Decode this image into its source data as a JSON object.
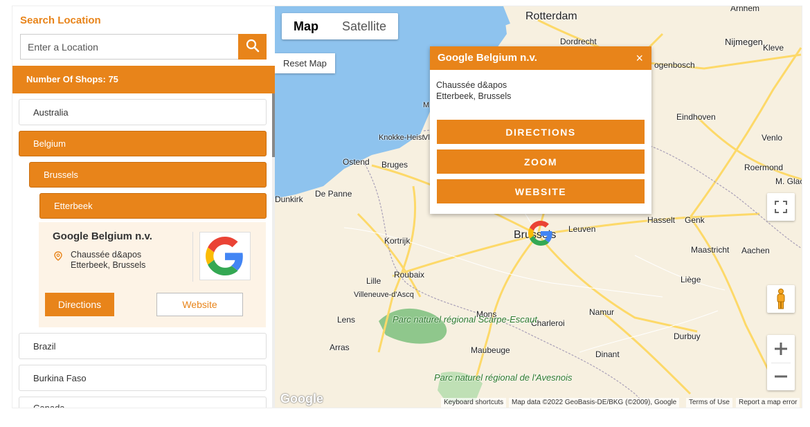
{
  "sidebar": {
    "title": "Search Location",
    "search_placeholder": "Enter a Location",
    "shop_count": "Number Of Shops: 75",
    "items": [
      "Australia",
      "Belgium",
      "Brussels",
      "Etterbeek",
      "Brazil",
      "Burkina Faso",
      "Canada"
    ],
    "shop": {
      "name": "Google Belgium n.v.",
      "address_line1": "Chaussée d&apos",
      "address_line2": "Etterbeek, Brussels",
      "directions_label": "Directions",
      "website_label": "Website"
    }
  },
  "map": {
    "type_map": "Map",
    "type_satellite": "Satellite",
    "reset_label": "Reset Map",
    "popup": {
      "title": "Google Belgium n.v.",
      "close": "×",
      "address_line1": "Chaussée d&apos",
      "address_line2": "Etterbeek, Brussels",
      "directions": "DIRECTIONS",
      "zoom": "ZOOM",
      "website": "WEBSITE"
    },
    "cities": {
      "rotterdam": "Rotterdam",
      "dordrecht": "Dordrecht",
      "nijmegen": "Nijmegen",
      "kleve": "Kleve",
      "arnhem": "Arnhem",
      "bosch": "ogenbosch",
      "eindhoven": "Eindhoven",
      "venlo": "Venlo",
      "roermond": "Roermond",
      "mglad": "M. Glac",
      "knokke": "Knokke-Heist",
      "vlis": "Vlis",
      "m": "M",
      "ostend": "Ostend",
      "bruges": "Bruges",
      "depanne": "De Panne",
      "dunkirk": "Dunkirk",
      "hasselt": "Hasselt",
      "genk": "Genk",
      "brussels": "Brussels",
      "leuven": "Leuven",
      "kortrijk": "Kortrijk",
      "maastricht": "Maastricht",
      "aachen": "Aachen",
      "lille": "Lille",
      "roubaix": "Roubaix",
      "liege": "Liège",
      "villeneuve": "Villeneuve-d'Ascq",
      "lens": "Lens",
      "mons": "Mons",
      "namur": "Namur",
      "charleroi": "Charleroi",
      "arras": "Arras",
      "maubeuge": "Maubeuge",
      "durbuy": "Durbuy",
      "dinant": "Dinant",
      "park1": "Parc naturel régional Scarpe-Escaut",
      "park2": "Parc naturel régional de l'Avesnois"
    },
    "attribution": {
      "google": "Google",
      "shortcuts": "Keyboard shortcuts",
      "data": "Map data ©2022 GeoBasis-DE/BKG (©2009), Google",
      "terms": "Terms of Use",
      "report": "Report a map error"
    },
    "colors": {
      "accent": "#e8841a",
      "water": "#8ec3ee",
      "land": "#f7f0e0",
      "road": "#fdd969"
    }
  }
}
